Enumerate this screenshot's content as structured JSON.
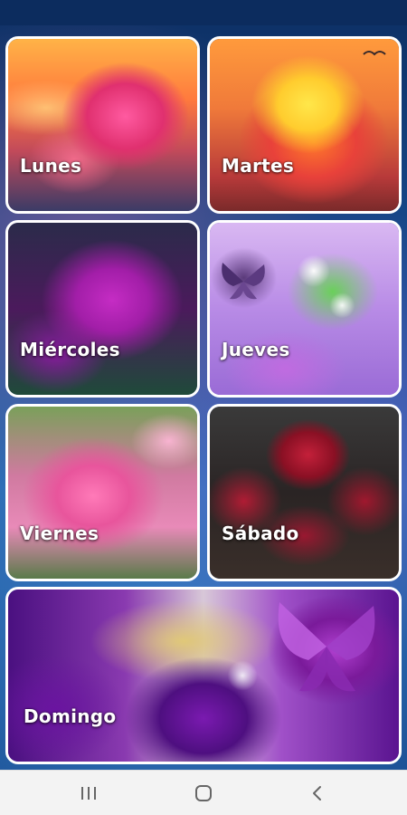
{
  "days": {
    "monday": "Lunes",
    "tuesday": "Martes",
    "wednesday": "Miércoles",
    "thursday": "Jueves",
    "friday": "Viernes",
    "saturday": "Sábado",
    "sunday": "Domingo"
  },
  "nav": {
    "recents_icon": "recents-icon",
    "home_icon": "home-icon",
    "back_icon": "back-icon"
  },
  "colors": {
    "tile_border": "#ffffff",
    "label_text": "#ffffff",
    "nav_bar_bg": "#f3f3f3",
    "nav_icon": "#666666"
  }
}
